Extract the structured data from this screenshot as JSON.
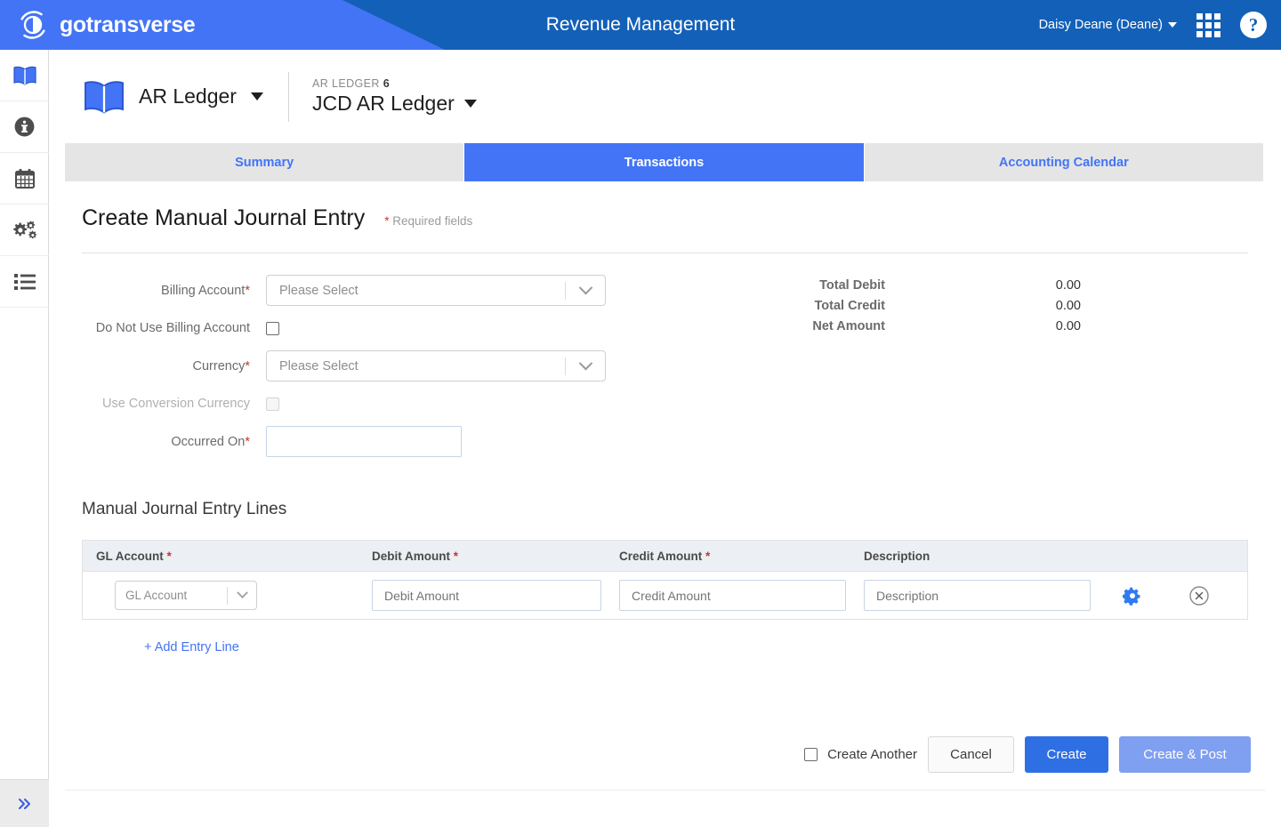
{
  "header": {
    "logo_text": "gotransverse",
    "logo_icon": "gotransverse-circle-icon",
    "app_title": "Revenue Management",
    "user_name": "Daisy Deane (Deane)",
    "apps_icon": "grid-apps-icon",
    "help_icon": "help-question-icon",
    "color_left": "#4274f5",
    "color_right": "#1360b8"
  },
  "sidebar": {
    "items": [
      {
        "icon": "book-icon",
        "name": "ledger",
        "active": true
      },
      {
        "icon": "info-circle-icon",
        "name": "information",
        "active": false
      },
      {
        "icon": "calendar-icon",
        "name": "calendar",
        "active": false
      },
      {
        "icon": "gears-icon",
        "name": "settings",
        "active": false
      },
      {
        "icon": "list-icon",
        "name": "reports",
        "active": false
      }
    ],
    "collapse_icon": "double-chevron-right-icon"
  },
  "ledger_bar": {
    "icon": "book-icon",
    "title": "AR Ledger",
    "eyebrow_label": "AR LEDGER",
    "eyebrow_number": "6",
    "ledger_name": "JCD AR Ledger"
  },
  "tabs": [
    {
      "label": "Summary",
      "active": false
    },
    {
      "label": "Transactions",
      "active": true
    },
    {
      "label": "Accounting Calendar",
      "active": false
    }
  ],
  "form": {
    "title": "Create Manual Journal Entry",
    "required_note": "Required fields",
    "required_star": "*",
    "fields": {
      "billing_account": {
        "label": "Billing Account",
        "required": "*",
        "placeholder": "Please Select",
        "value": ""
      },
      "do_not_use_billing_account": {
        "label": "Do Not Use Billing Account",
        "checked": false
      },
      "currency": {
        "label": "Currency",
        "required": "*",
        "placeholder": "Please Select",
        "value": ""
      },
      "use_conversion_currency": {
        "label": "Use Conversion Currency",
        "checked": false,
        "disabled": true
      },
      "occurred_on": {
        "label": "Occurred On",
        "required": "*",
        "value": "",
        "placeholder": ""
      }
    }
  },
  "totals": [
    {
      "label": "Total Debit",
      "value": "0.00"
    },
    {
      "label": "Total Credit",
      "value": "0.00"
    },
    {
      "label": "Net Amount",
      "value": "0.00"
    }
  ],
  "lines": {
    "section_title": "Manual Journal Entry Lines",
    "columns": [
      {
        "label": "GL Account",
        "required": "*"
      },
      {
        "label": "Debit Amount",
        "required": "*"
      },
      {
        "label": "Credit Amount",
        "required": "*"
      },
      {
        "label": "Description",
        "required": ""
      }
    ],
    "rows": [
      {
        "gl_account_placeholder": "GL Account",
        "gl_account_value": "",
        "debit_placeholder": "Debit Amount",
        "debit_value": "",
        "credit_placeholder": "Credit Amount",
        "credit_value": "",
        "description_placeholder": "Description",
        "description_value": "",
        "settings_icon": "gear-icon",
        "remove_icon": "circle-x-icon"
      }
    ],
    "add_line_label": "+ Add Entry Line"
  },
  "footer": {
    "create_another_label": "Create Another",
    "create_another_checked": false,
    "cancel_label": "Cancel",
    "create_label": "Create",
    "create_post_label": "Create & Post"
  },
  "colors": {
    "accent_blue": "#4274f5",
    "dark_blue": "#1360b8",
    "required_red": "#c0392b",
    "tab_inactive_bg": "#e5e5e5",
    "table_head_bg": "#eceff4"
  }
}
